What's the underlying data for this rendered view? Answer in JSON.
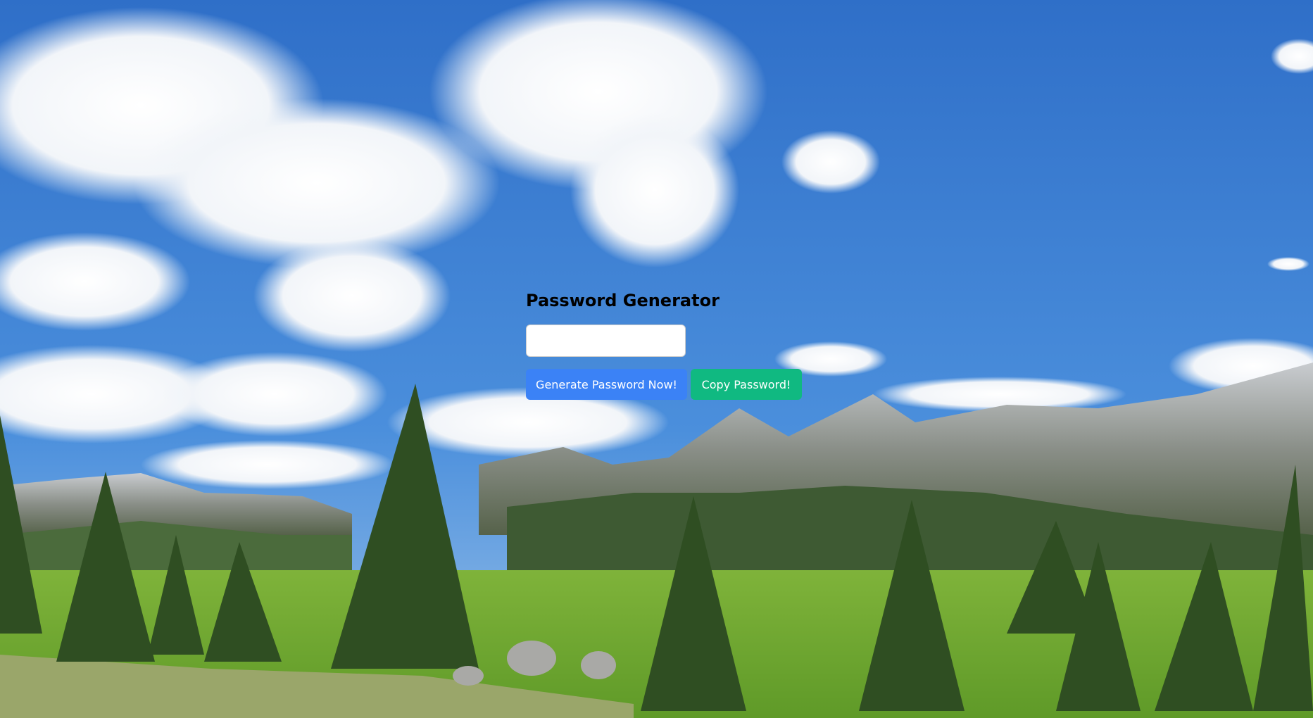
{
  "page": {
    "title": "Password Generator",
    "password_value": "",
    "generate_label": "Generate Password Now!",
    "copy_label": "Copy Password!"
  },
  "colors": {
    "generate_button": "#3b82f6",
    "copy_button": "#10b981",
    "sky": "#3f83d6"
  },
  "background": {
    "icon": "mountain-landscape-photo"
  }
}
